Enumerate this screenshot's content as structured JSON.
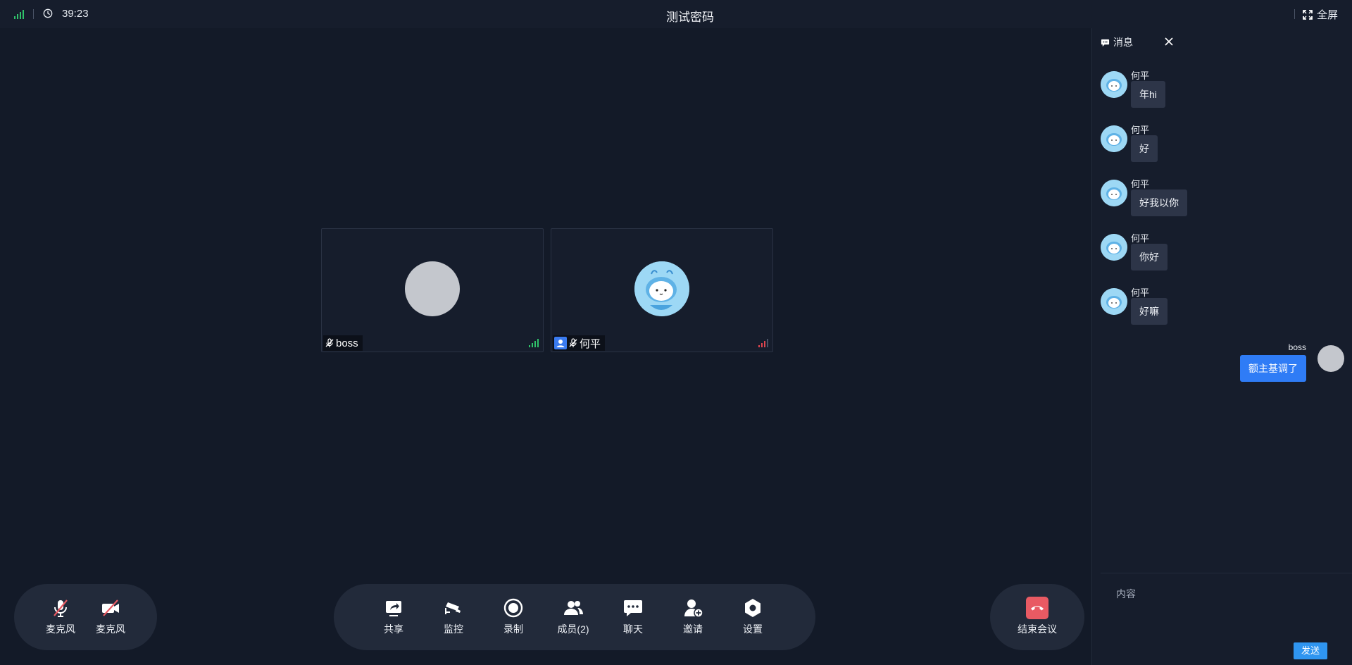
{
  "topbar": {
    "time": "39:23",
    "title": "测试密码",
    "fullscreen_label": "全屏"
  },
  "tiles": [
    {
      "name": "boss",
      "muted": true,
      "signal": "good"
    },
    {
      "name": "何平",
      "muted": true,
      "signal": "poor"
    }
  ],
  "chat": {
    "title": "消息",
    "messages": [
      {
        "sender": "何平",
        "text": "年hi"
      },
      {
        "sender": "何平",
        "text": "好"
      },
      {
        "sender": "何平",
        "text": "好我以你"
      },
      {
        "sender": "何平",
        "text": "你好"
      },
      {
        "sender": "何平",
        "text": "好嘛"
      }
    ],
    "self_message": {
      "sender": "boss",
      "text": "额主基调了"
    },
    "input_placeholder": "内容",
    "send_label": "发送"
  },
  "left_controls": [
    {
      "label": "麦克风",
      "icon": "mic-off-icon"
    },
    {
      "label": "麦克风",
      "icon": "camera-off-icon"
    }
  ],
  "toolbar": [
    {
      "label": "共享",
      "icon": "share-icon"
    },
    {
      "label": "监控",
      "icon": "camera-monitor-icon"
    },
    {
      "label": "录制",
      "icon": "record-icon"
    },
    {
      "label": "成员(2)",
      "icon": "members-icon"
    },
    {
      "label": "聊天",
      "icon": "chat-icon"
    },
    {
      "label": "邀请",
      "icon": "invite-icon"
    },
    {
      "label": "设置",
      "icon": "settings-icon"
    }
  ],
  "end_meeting": {
    "label": "结束会议",
    "icon": "hangup-icon"
  },
  "colors": {
    "background": "#131a28",
    "panel": "#161d2c",
    "accent": "#2f7cf6",
    "signal_good": "#2fc26a",
    "signal_poor": "#e0454f",
    "hangup": "#e85a63"
  }
}
